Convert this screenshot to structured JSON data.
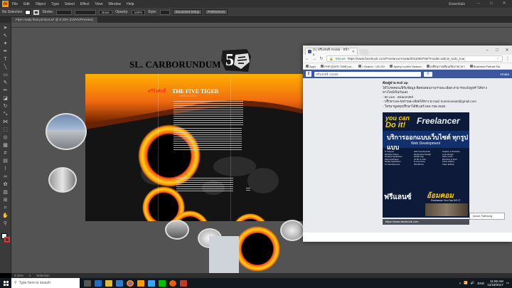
{
  "illustrator": {
    "logo": "Ai",
    "menu": [
      "File",
      "Edit",
      "Object",
      "Type",
      "Select",
      "Effect",
      "View",
      "Window",
      "Help"
    ],
    "workspace": "Essentials",
    "control_bar": {
      "selection": "No Selection",
      "stroke_label": "Stroke:",
      "basic": "Basic",
      "opacity_label": "Opacity:",
      "opacity_value": "100%",
      "style_label": "Style:",
      "document_setup": "Document Setup",
      "preferences": "Preferences"
    },
    "document_tab": "Flyer ready final printcut.ai* @ 8.33% (CMYK/Preview)",
    "status": {
      "zoom": "8.33%",
      "page": "1",
      "tool": "Selection"
    }
  },
  "artwork": {
    "company_title": "SL. CARBORUNDUM",
    "logo_text": "5",
    "brochure_heading": "THE FIVE TIGER",
    "brochure_sub": "ABRASIVES",
    "brochure_mini_logo": "ศรีจีรศักดิ์"
  },
  "browser": {
    "tab_title": "(1) ฟรีแลนซ์ Amata - หน้าแ",
    "url": "https://www.facebook.com/FreelanceAmata/2011050769/?modal=admin_todo_tour",
    "secure_label": "Secure",
    "bookmarks": [
      "Apps",
      "PHP [DATE TIME] un...",
      "• Search - US-SO",
      "Jquery Lucifer Season",
      "เปลี่ยนรายเดือนเป็นรายเวลา",
      "Business Portrait Stu"
    ],
    "fb_search_placeholder": "ฟรีแลนซ์ Amata",
    "fb_user": "Amata",
    "post_lines": [
      "ตั้งอยู่ย่าน Roll Up",
      "ได้โปรดคอนเฟิร์มข้อมูล ติดต่อสอบถามรายละเอียด สามารถแจ้งลูกค้าได้ทาง",
      "ทางไลน์เป็นกันเอง",
      "- ID Line : 2Ikamm00l",
      "- ปรึกษาและขอรายละเอียดได้ทาง E-mail: kommoosart@gmail.com",
      "- โทรมาพูดคุยปรึกษาได้ที่เบอร์ 064-765-4538"
    ],
    "ad": {
      "you_can": "you can",
      "do_it": "Do it!",
      "freelancer": "Freelancer",
      "service": "บริการออกแบบเว็บไซต์ ทุกรูปแบบ",
      "web_dev": "Web Development",
      "list_a": [
        "IT Support",
        "Windows Setup",
        "Desktop Application",
        "Web Application",
        "Mobile Application",
        "IoT Development"
      ],
      "list_b": [
        "Web Development",
        "Responsive Design",
        "Mobile App",
        "HTML & CSS",
        "E-commerce",
        "WordPress"
      ],
      "list_c": [
        "Graphic & Illustrator",
        "Logo Design",
        "Name Card",
        "Brochure & Flyer",
        "Photo Editing",
        "Video Editing"
      ],
      "freelance": "ฟรีแลนซ์",
      "brand": "อ้อมคอม",
      "tagline": "Freelancer You Can DO IT"
    },
    "link_preview": "https://www.facebook.com",
    "about_popup": "About Fatthong"
  },
  "taskbar": {
    "search_placeholder": "Type here to search",
    "time": "11:55 AM",
    "date": "12/18/2017",
    "language": "ENG"
  }
}
